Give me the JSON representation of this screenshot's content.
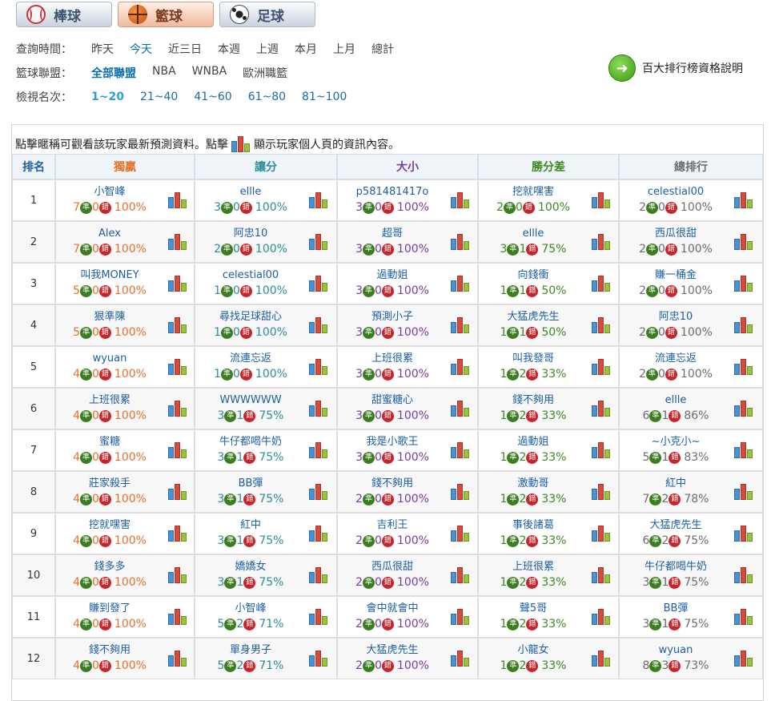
{
  "sport_tabs": [
    {
      "label": "棒球",
      "icon": "baseball-icon",
      "active": false
    },
    {
      "label": "籃球",
      "icon": "basketball-icon",
      "active": true
    },
    {
      "label": "足球",
      "icon": "soccer-icon",
      "active": false
    }
  ],
  "filters": {
    "time": {
      "label": "查詢時間：",
      "options": [
        "昨天",
        "今天",
        "近三日",
        "本週",
        "上週",
        "本月",
        "上月",
        "總計"
      ],
      "selected": "今天"
    },
    "league": {
      "label": "籃球聯盟：",
      "options": [
        "全部聯盟",
        "NBA",
        "WNBA",
        "歐洲職籃"
      ],
      "selected": "全部聯盟"
    },
    "rank": {
      "label": "檢視名次：",
      "options": [
        "1~20",
        "21~40",
        "41~60",
        "61~80",
        "81~100"
      ],
      "selected": "1~20"
    }
  },
  "help_link": "百大排行榜資格說明",
  "notice": {
    "before": "點擊暱稱可觀看該玩家最新預測資料。點擊",
    "after": "顯示玩家個人頁的資訊內容。"
  },
  "columns": [
    {
      "label": "排名",
      "color": "#1c5fa5"
    },
    {
      "label": "獨贏",
      "color": "#e8712d"
    },
    {
      "label": "讓分",
      "color": "#2a8d9c"
    },
    {
      "label": "大小",
      "color": "#7a3d9e"
    },
    {
      "label": "勝分差",
      "color": "#3b8a1f"
    },
    {
      "label": "總排行",
      "color": "#6d6d6d"
    }
  ],
  "mark_labels": {
    "win": "準",
    "lose": "錯"
  },
  "rows": [
    {
      "rank": "1",
      "cells": [
        {
          "name": "小智峰",
          "w": "7",
          "l": "0",
          "pct": "100%"
        },
        {
          "name": "ellle",
          "w": "3",
          "l": "0",
          "pct": "100%"
        },
        {
          "name": "p581481417o",
          "w": "3",
          "l": "0",
          "pct": "100%"
        },
        {
          "name": "挖就嘿害",
          "w": "2",
          "l": "0",
          "pct": "100%"
        },
        {
          "name": "celestial00",
          "w": "2",
          "l": "0",
          "pct": "100%"
        }
      ]
    },
    {
      "rank": "2",
      "cells": [
        {
          "name": "Alex",
          "w": "7",
          "l": "0",
          "pct": "100%"
        },
        {
          "name": "阿忠10",
          "w": "2",
          "l": "0",
          "pct": "100%"
        },
        {
          "name": "超哥",
          "w": "3",
          "l": "0",
          "pct": "100%"
        },
        {
          "name": "ellle",
          "w": "3",
          "l": "1",
          "pct": "75%"
        },
        {
          "name": "西瓜很甜",
          "w": "2",
          "l": "0",
          "pct": "100%"
        }
      ]
    },
    {
      "rank": "3",
      "cells": [
        {
          "name": "叫我MONEY",
          "w": "5",
          "l": "0",
          "pct": "100%"
        },
        {
          "name": "celestial00",
          "w": "1",
          "l": "0",
          "pct": "100%"
        },
        {
          "name": "過動姐",
          "w": "3",
          "l": "0",
          "pct": "100%"
        },
        {
          "name": "向錢衝",
          "w": "1",
          "l": "1",
          "pct": "50%"
        },
        {
          "name": "賺一桶金",
          "w": "2",
          "l": "0",
          "pct": "100%"
        }
      ]
    },
    {
      "rank": "4",
      "cells": [
        {
          "name": "狠準陳",
          "w": "5",
          "l": "0",
          "pct": "100%"
        },
        {
          "name": "尋找足球甜心",
          "w": "1",
          "l": "0",
          "pct": "100%"
        },
        {
          "name": "預測小子",
          "w": "3",
          "l": "0",
          "pct": "100%"
        },
        {
          "name": "大猛虎先生",
          "w": "1",
          "l": "1",
          "pct": "50%"
        },
        {
          "name": "阿忠10",
          "w": "2",
          "l": "0",
          "pct": "100%"
        }
      ]
    },
    {
      "rank": "5",
      "cells": [
        {
          "name": "wyuan",
          "w": "4",
          "l": "0",
          "pct": "100%"
        },
        {
          "name": "流連忘返",
          "w": "1",
          "l": "0",
          "pct": "100%"
        },
        {
          "name": "上班很累",
          "w": "3",
          "l": "0",
          "pct": "100%"
        },
        {
          "name": "叫我發哥",
          "w": "1",
          "l": "2",
          "pct": "33%"
        },
        {
          "name": "流連忘返",
          "w": "2",
          "l": "0",
          "pct": "100%"
        }
      ]
    },
    {
      "rank": "6",
      "cells": [
        {
          "name": "上班很累",
          "w": "4",
          "l": "0",
          "pct": "100%"
        },
        {
          "name": "WWWWWW",
          "w": "3",
          "l": "1",
          "pct": "75%"
        },
        {
          "name": "甜蜜糖心",
          "w": "3",
          "l": "0",
          "pct": "100%"
        },
        {
          "name": "錢不夠用",
          "w": "1",
          "l": "2",
          "pct": "33%"
        },
        {
          "name": "ellle",
          "w": "6",
          "l": "1",
          "pct": "86%"
        }
      ]
    },
    {
      "rank": "7",
      "cells": [
        {
          "name": "蜜糖",
          "w": "4",
          "l": "0",
          "pct": "100%"
        },
        {
          "name": "牛仔都喝牛奶",
          "w": "3",
          "l": "1",
          "pct": "75%"
        },
        {
          "name": "我是小歌王",
          "w": "3",
          "l": "0",
          "pct": "100%"
        },
        {
          "name": "過動姐",
          "w": "1",
          "l": "2",
          "pct": "33%"
        },
        {
          "name": "~小克小~",
          "w": "5",
          "l": "1",
          "pct": "83%"
        }
      ]
    },
    {
      "rank": "8",
      "cells": [
        {
          "name": "莊家殺手",
          "w": "4",
          "l": "0",
          "pct": "100%"
        },
        {
          "name": "BB彈",
          "w": "3",
          "l": "1",
          "pct": "75%"
        },
        {
          "name": "錢不夠用",
          "w": "2",
          "l": "0",
          "pct": "100%"
        },
        {
          "name": "激動哥",
          "w": "1",
          "l": "2",
          "pct": "33%"
        },
        {
          "name": "紅中",
          "w": "7",
          "l": "2",
          "pct": "78%"
        }
      ]
    },
    {
      "rank": "9",
      "cells": [
        {
          "name": "挖就嘿害",
          "w": "4",
          "l": "0",
          "pct": "100%"
        },
        {
          "name": "紅中",
          "w": "3",
          "l": "1",
          "pct": "75%"
        },
        {
          "name": "吉利王",
          "w": "2",
          "l": "0",
          "pct": "100%"
        },
        {
          "name": "事後諸葛",
          "w": "1",
          "l": "2",
          "pct": "33%"
        },
        {
          "name": "大猛虎先生",
          "w": "6",
          "l": "2",
          "pct": "75%"
        }
      ]
    },
    {
      "rank": "10",
      "cells": [
        {
          "name": "錢多多",
          "w": "4",
          "l": "0",
          "pct": "100%"
        },
        {
          "name": "嬌嬌女",
          "w": "3",
          "l": "1",
          "pct": "75%"
        },
        {
          "name": "西瓜很甜",
          "w": "2",
          "l": "0",
          "pct": "100%"
        },
        {
          "name": "上班很累",
          "w": "1",
          "l": "2",
          "pct": "33%"
        },
        {
          "name": "牛仔都喝牛奶",
          "w": "3",
          "l": "1",
          "pct": "75%"
        }
      ]
    },
    {
      "rank": "11",
      "cells": [
        {
          "name": "賺到發了",
          "w": "4",
          "l": "0",
          "pct": "100%"
        },
        {
          "name": "小智峰",
          "w": "5",
          "l": "2",
          "pct": "71%"
        },
        {
          "name": "會中就會中",
          "w": "2",
          "l": "0",
          "pct": "100%"
        },
        {
          "name": "聲5哥",
          "w": "1",
          "l": "2",
          "pct": "33%"
        },
        {
          "name": "BB彈",
          "w": "3",
          "l": "1",
          "pct": "75%"
        }
      ]
    },
    {
      "rank": "12",
      "cells": [
        {
          "name": "錢不夠用",
          "w": "4",
          "l": "0",
          "pct": "100%"
        },
        {
          "name": "單身男子",
          "w": "5",
          "l": "2",
          "pct": "71%"
        },
        {
          "name": "大猛虎先生",
          "w": "2",
          "l": "0",
          "pct": "100%"
        },
        {
          "name": "小龍女",
          "w": "1",
          "l": "2",
          "pct": "33%"
        },
        {
          "name": "wyuan",
          "w": "8",
          "l": "3",
          "pct": "73%"
        }
      ]
    }
  ]
}
